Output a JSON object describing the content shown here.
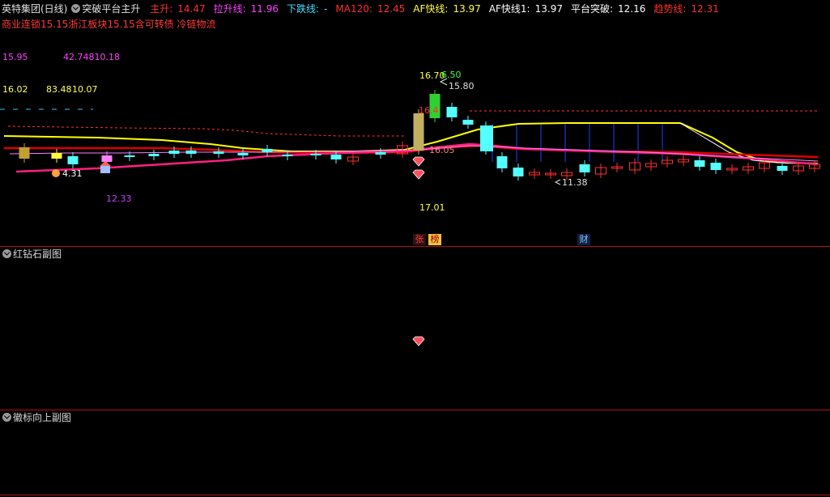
{
  "header": {
    "stock_name": "英特集团(日线)",
    "indicator_name": "突破平台主升",
    "items": [
      {
        "label": "主升:",
        "value": "14.47",
        "color": "#ff3030"
      },
      {
        "label": "拉升线:",
        "value": "11.96",
        "color": "#ff40ff"
      },
      {
        "label": "下跌线:",
        "value": "-",
        "color": "#40e0ff"
      },
      {
        "label": "MA120:",
        "value": "12.45",
        "color": "#ff3030"
      },
      {
        "label": "AF快线:",
        "value": "13.97",
        "color": "#ffff40"
      },
      {
        "label": "AF快线1:",
        "value": "13.97",
        "color": "#ffffff"
      },
      {
        "label": "平台突破:",
        "value": "12.16",
        "color": "#ffffff"
      },
      {
        "label": "趋势线:",
        "value": "12.31",
        "color": "#ff3030"
      }
    ]
  },
  "sectors_line": "商业连锁15.15浙江板块15.15含可转债 冷链物流",
  "price_labels": {
    "left_mag_1": "15.95",
    "left_mag_2": "42.74810.18",
    "left_yel_1": "16.02",
    "left_yel_2": "83.48",
    "left_yel_3": "10.07",
    "left_low": "4.31",
    "left_purple": "12.33",
    "peak_yellow": "16.70",
    "peak_green": "6.50",
    "peak_white": "15.80",
    "peak_red": "16.4",
    "mid_label": "16.05",
    "low_right": "11.38",
    "bottom_yellow": "17.01"
  },
  "badges": {
    "zhang": "张",
    "bang": "榜",
    "cai": "财"
  },
  "panes": {
    "sub1_title": "红钻石副图",
    "sub2_title": "徽标向上副图"
  },
  "colors": {
    "up": "#ff3030",
    "down": "#54ffff",
    "yellow_line": "#ffff00",
    "pink_line": "#ff2080",
    "red_line": "#e00000",
    "border": "#b0101a"
  }
}
